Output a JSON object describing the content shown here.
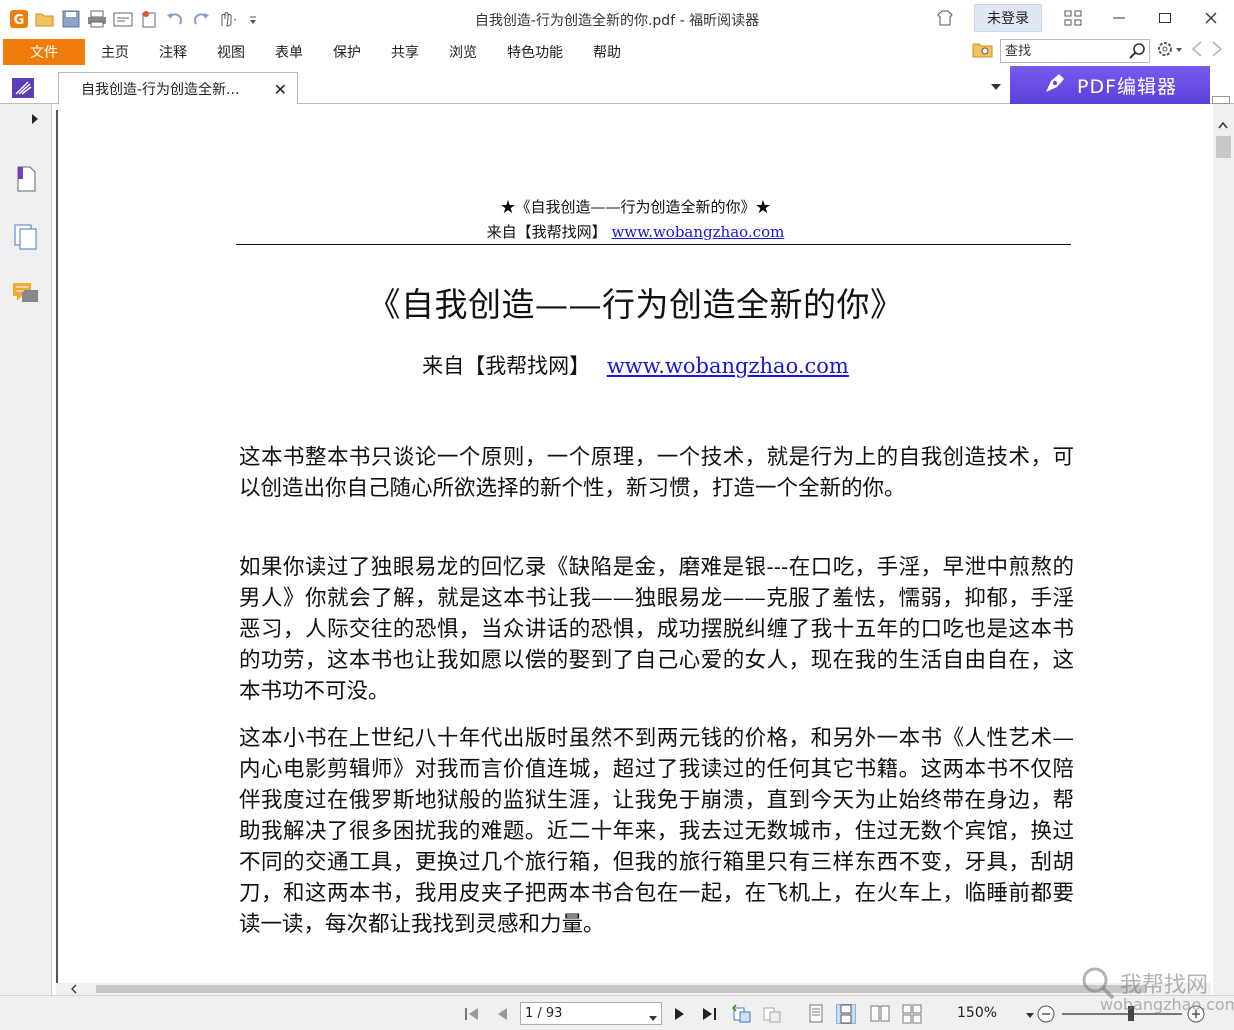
{
  "window": {
    "title": "自我创造-行为创造全新的你.pdf - 福昕阅读器",
    "login_label": "未登录"
  },
  "menu": {
    "file": "文件",
    "items": [
      "主页",
      "注释",
      "视图",
      "表单",
      "保护",
      "共享",
      "浏览",
      "特色功能",
      "帮助"
    ]
  },
  "search": {
    "placeholder": "查找"
  },
  "tab": {
    "label": "自我创造-行为创造全新..."
  },
  "pdf_editor": {
    "label": "PDF编辑器"
  },
  "document": {
    "header_line1": "★《自我创造——行为创造全新的你》★",
    "header_prefix": "来自【我帮找网】",
    "header_link": "www.wobangzhao.com",
    "title": "《自我创造——行为创造全新的你》",
    "source_prefix": "来自【我帮找网】",
    "source_link": "www.wobangzhao.com",
    "paragraphs": [
      "这本书整本书只谈论一个原则，一个原理，一个技术，就是行为上的自我创造技术，可以创造出你自己随心所欲选择的新个性，新习惯，打造一个全新的你。",
      "如果你读过了独眼易龙的回忆录《缺陷是金，磨难是银---在口吃，手淫，早泄中煎熬的男人》你就会了解，就是这本书让我——独眼易龙——克服了羞怯，懦弱，抑郁，手淫恶习，人际交往的恐惧，当众讲话的恐惧，成功摆脱纠缠了我十五年的口吃也是这本书的功劳，这本书也让我如愿以偿的娶到了自己心爱的女人，现在我的生活自由自在，这本书功不可没。",
      "这本小书在上世纪八十年代出版时虽然不到两元钱的价格，和另外一本书《人性艺术—内心电影剪辑师》对我而言价值连城，超过了我读过的任何其它书籍。这两本书不仅陪伴我度过在俄罗斯地狱般的监狱生涯，让我免于崩溃，直到今天为止始终带在身边，帮助我解决了很多困扰我的难题。近二十年来，我去过无数城市，住过无数个宾馆，换过不同的交通工具，更换过几个旅行箱，但我的旅行箱里只有三样东西不变，牙具，刮胡刀，和这两本书，我用皮夹子把两本书合包在一起，在飞机上，在火车上，临睡前都要读一读，每次都让我找到灵感和力量。"
    ]
  },
  "status": {
    "page": "1 / 93",
    "zoom": "150%"
  },
  "watermark": {
    "line1": "我帮找网",
    "line2": "wobangzhao.com"
  },
  "colors": {
    "file_tab": "#f07d0b",
    "pdf_editor": "#6a4de6",
    "link": "#1a18d8"
  }
}
